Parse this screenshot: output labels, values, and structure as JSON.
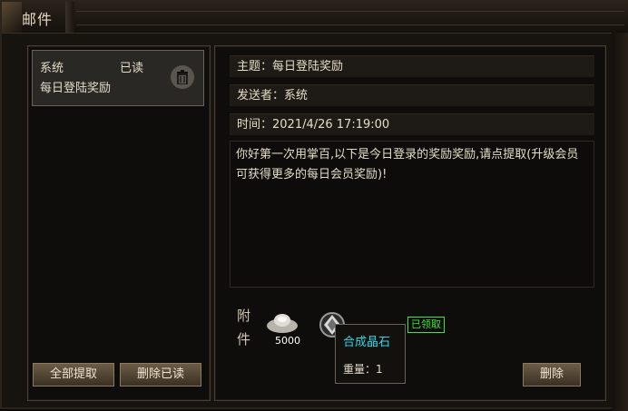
{
  "window": {
    "title": "邮件"
  },
  "mail_list": [
    {
      "sender": "系统",
      "status": "已读",
      "subject": "每日登陆奖励"
    }
  ],
  "detail": {
    "subject_line": "主题：每日登陆奖励",
    "sender_line": "发送者：系统",
    "time_line": "时间：2021/4/26 17:19:00",
    "body": "你好第一次用掌百,以下是今日登录的奖励奖励,请点提取(升级会员可获得更多的每日会员奖励)!"
  },
  "attachments": {
    "label": "附件",
    "items": [
      {
        "icon": "silver-ingot-icon",
        "quantity": "5000"
      },
      {
        "icon": "crystal-stone-icon",
        "claimed_badge": "已领取"
      }
    ],
    "tooltip": {
      "name": "合成晶石",
      "weight": "重量：1"
    }
  },
  "buttons": {
    "claim_all": "全部提取",
    "delete_read": "删除已读",
    "delete": "删除"
  },
  "colors": {
    "tooltip_name": "#2fd6e8",
    "claimed_badge": "#3ce63c"
  }
}
